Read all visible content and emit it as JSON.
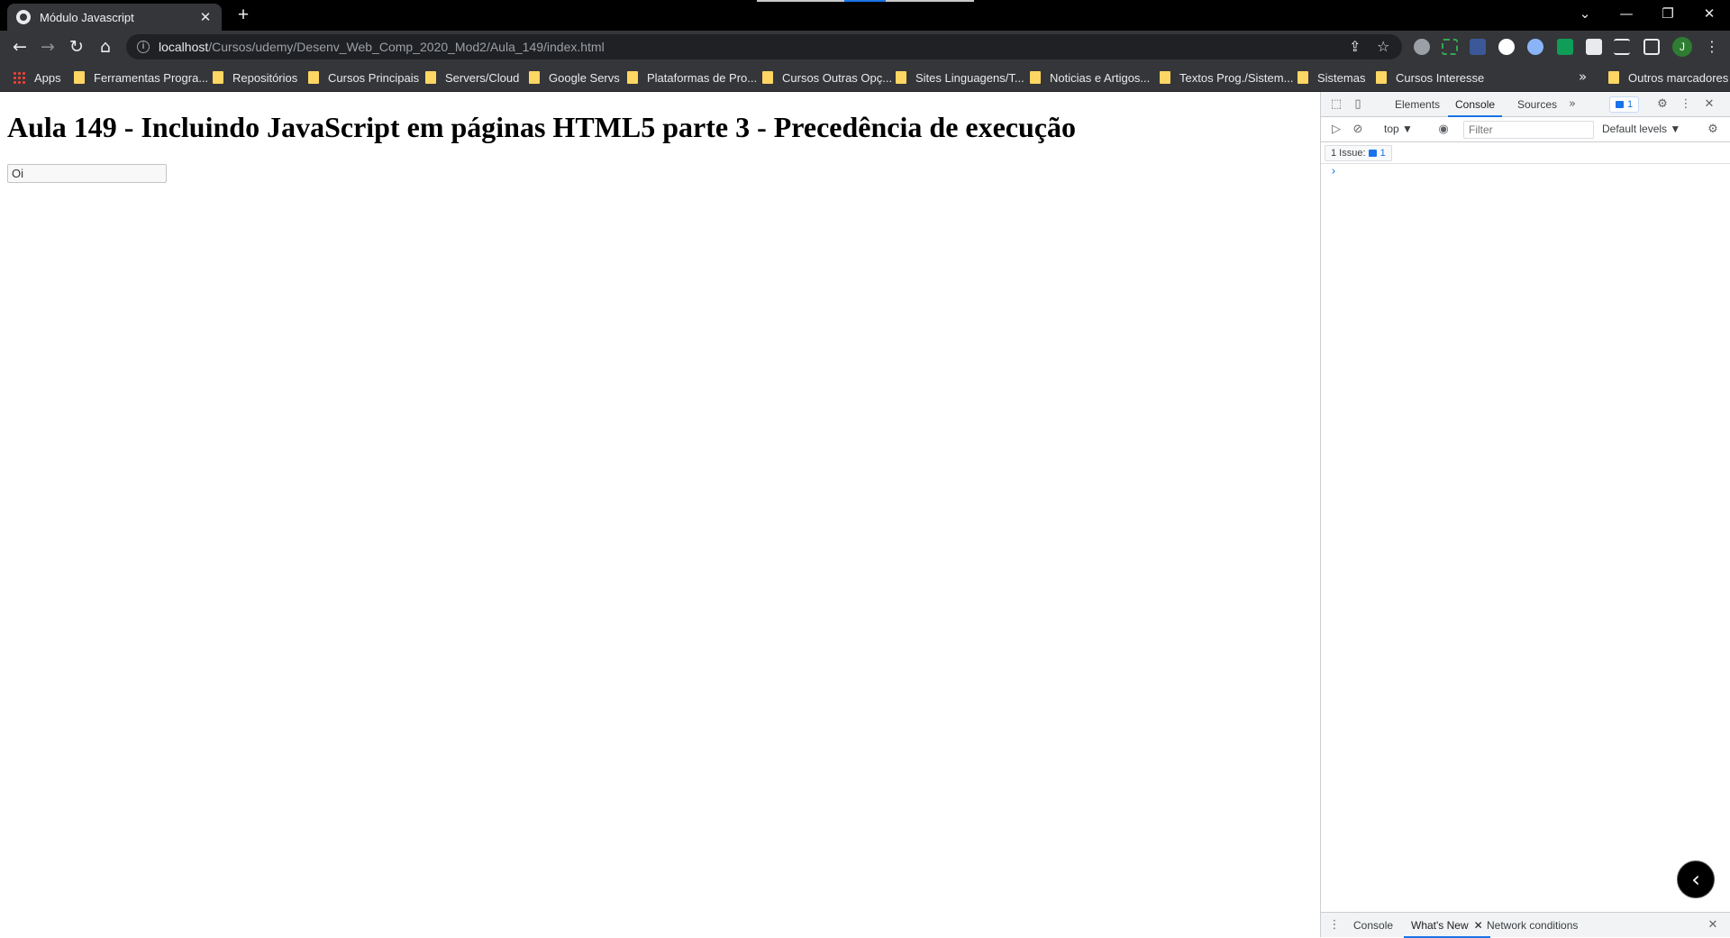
{
  "browser": {
    "tab_title": "Módulo Javascript",
    "tab_close": "✕",
    "new_tab": "+",
    "url_host": "localhost",
    "url_path": "/Cursos/udemy/Desenv_Web_Comp_2020_Mod2/Aula_149/index.html",
    "profile_initial": "J",
    "window_controls": {
      "dropdown": "⌄",
      "minimize": "—",
      "restore": "❐",
      "close": "✕"
    },
    "icons": {
      "back": "←",
      "forward": "→",
      "reload": "↻",
      "home": "⌂",
      "share": "⇪",
      "star": "☆",
      "menu": "⋮"
    }
  },
  "bookmarks": {
    "items": [
      "Apps",
      "Ferramentas Progra...",
      "Repositórios",
      "Cursos Principais",
      "Servers/Cloud",
      "Google Servs",
      "Plataformas de Pro...",
      "Cursos Outras Opç...",
      "Sites Linguagens/T...",
      "Noticias e Artigos...",
      "Textos Prog./Sistem...",
      "Sistemas",
      "Cursos Interesse"
    ],
    "more": "»",
    "other": "Outros marcadores"
  },
  "page": {
    "heading": "Aula 149 - Incluindo JavaScript em páginas HTML5 parte 3 - Precedência de execução",
    "input_value": "Oi"
  },
  "devtools": {
    "tabs": [
      "Elements",
      "Console",
      "Sources"
    ],
    "active_tab": "Console",
    "more_tabs": "»",
    "issue_badge_count": "1",
    "context": "top ▼",
    "filter_placeholder": "Filter",
    "levels": "Default levels ▼",
    "issues_label": "1 Issue:",
    "issues_count": "1",
    "prompt": "›",
    "drawer_tabs": [
      "Console",
      "What's New",
      "Network conditions"
    ],
    "drawer_active": "What's New",
    "drawer_close": "✕",
    "fab_icon": "‹"
  },
  "colors": {
    "accent": "#1a73e8",
    "chrome_bg": "#35363a",
    "folder": "#fdd663"
  }
}
